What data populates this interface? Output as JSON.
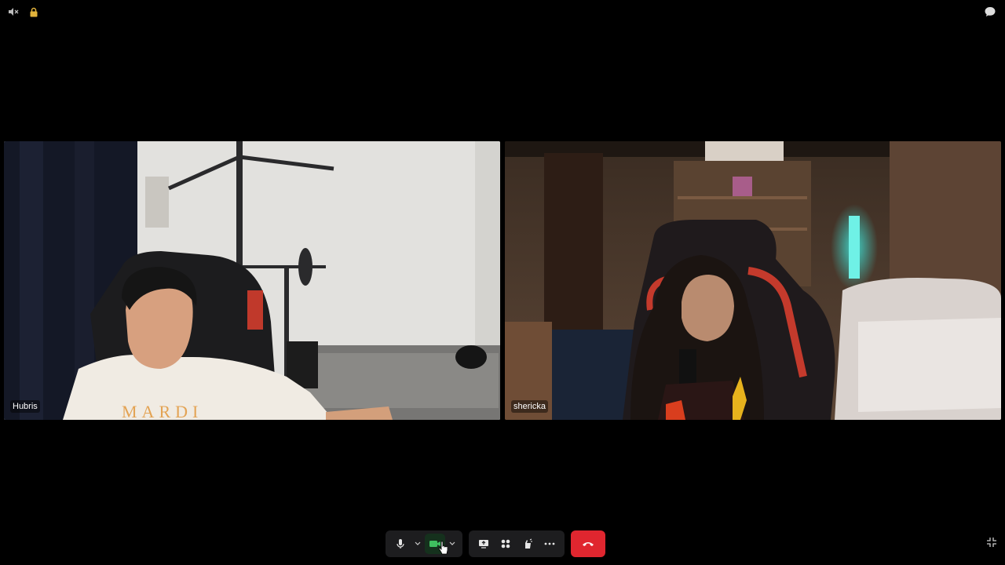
{
  "topbar": {
    "left_icons": [
      "speaker-muted-icon",
      "lock-icon"
    ],
    "right_icon": "chat-bubble-icon"
  },
  "participants": [
    {
      "name": "Hubris"
    },
    {
      "name": "shericka"
    }
  ],
  "toolbar": {
    "buttons": [
      "microphone-icon",
      "chevron-down-icon",
      "camera-icon",
      "chevron-down-icon",
      "share-screen-icon",
      "apps-grid-icon",
      "reactions-icon",
      "more-icon",
      "hang-up-icon"
    ],
    "accent_colors": {
      "camera_on": "#3fbf5f",
      "leave": "#e0262f"
    }
  },
  "corner_icon": "exit-fullscreen-icon"
}
